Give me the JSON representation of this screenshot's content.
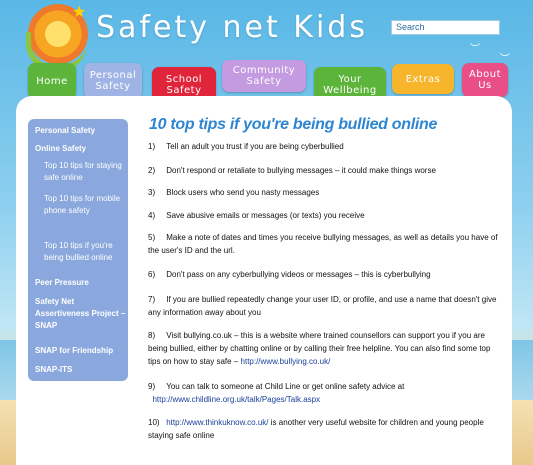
{
  "header": {
    "site_title": "Safety net Kids",
    "search_placeholder": "Search"
  },
  "nav": [
    {
      "label": "Home",
      "color": "#5cb43a"
    },
    {
      "label": "Personal Safety",
      "color": "#9fb3e4"
    },
    {
      "label": "School Safety",
      "color": "#e0243a"
    },
    {
      "label": "Community Safety",
      "color": "#c49ae0"
    },
    {
      "label": "Your Wellbeing",
      "color": "#5cb43a"
    },
    {
      "label": "Extras",
      "color": "#f6b52a"
    },
    {
      "label": "About Us",
      "color": "#e94f86"
    }
  ],
  "sidebar": {
    "items": [
      {
        "label": "Personal Safety"
      },
      {
        "label": "Online Safety"
      },
      {
        "label": "Top 10 tips for staying safe online"
      },
      {
        "label": "Top 10 tips for mobile phone safety"
      },
      {
        "label": "Top 10 tips if you're being bullied online"
      },
      {
        "label": "Peer Pressure"
      },
      {
        "label": "Safety Net Assertiveness Project – SNAP"
      },
      {
        "label": "SNAP for Friendship"
      },
      {
        "label": "SNAP-ITS"
      }
    ]
  },
  "main": {
    "heading": "10 top tips if you're being bullied online",
    "tips": [
      {
        "num": "1)",
        "text": "Tell an adult you trust if you are being cyberbullied"
      },
      {
        "num": "2)",
        "text": "Don't respond or retaliate to bullying messages  – it could make things worse"
      },
      {
        "num": "3)",
        "text": "Block users who send you nasty messages"
      },
      {
        "num": "4)",
        "text": "Save abusive emails or messages (or texts) you receive"
      },
      {
        "num": "5)",
        "text": "Make a note of dates and times you receive bullying messages, as well as details you have of the user's ID and the url."
      },
      {
        "num": "6)",
        "text": "Don't pass on any cyberbullying videos or messages – this is cyberbullying"
      },
      {
        "num": "7)",
        "text": "If you are bullied repeatedly change your user ID, or profile,  and use a name that doesn't give any information away about you"
      },
      {
        "num": "8)",
        "text": "Visit bullying.co.uk – this is a website where trained counsellors can support you if you are being bullied, either by chatting online or by calling their free helpline. You can also find some top tips on how to stay safe –",
        "link": "http://www.bullying.co.uk/"
      },
      {
        "num": "9)",
        "text": "You can talk to someone at Child Line or get online safety advice at",
        "link": "http://www.childline.org.uk/talk/Pages/Talk.aspx"
      },
      {
        "num": "10)",
        "link": "http://www.thinkuknow.co.uk/",
        "text": "is another very useful website for children and young people staying safe online"
      }
    ]
  }
}
